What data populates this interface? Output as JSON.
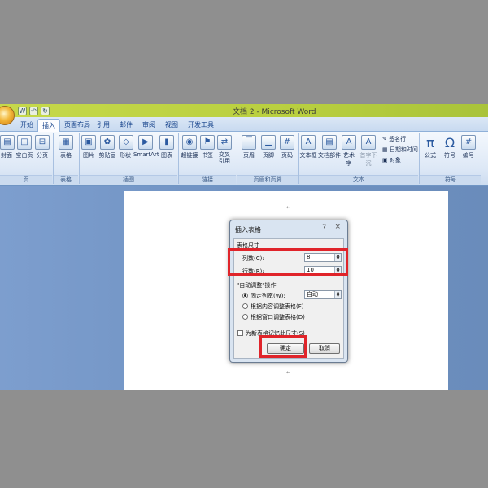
{
  "window": {
    "title": "文档 2 - Microsoft Word"
  },
  "qat": [
    "W",
    "↶",
    "↻"
  ],
  "tabs": [
    "开始",
    "插入",
    "页面布局",
    "引用",
    "邮件",
    "审阅",
    "视图",
    "开发工具"
  ],
  "ribbon": {
    "buttons": [
      "封面",
      "空白页",
      "分页",
      "表格",
      "图片",
      "剪贴画",
      "形状",
      "SmartArt",
      "图表",
      "超链接",
      "书签",
      "交叉\n引用",
      "页眉",
      "页脚",
      "页码",
      "文本框",
      "文档部件",
      "艺术字",
      "首字下沉",
      "公式",
      "符号",
      "编号"
    ],
    "small": [
      "签名行",
      "日期和时间",
      "对象"
    ],
    "groups": [
      "页",
      "表格",
      "插图",
      "链接",
      "页眉和页脚",
      "文本",
      "符号"
    ],
    "icons": {
      "pi": "π",
      "omega": "Ω"
    }
  },
  "document": {
    "para_mark": "↵"
  },
  "dialog": {
    "title": "插入表格",
    "help": "?",
    "close": "×",
    "size_group": "表格尺寸",
    "columns_label": "列数(C):",
    "columns_value": "8",
    "rows_label": "行数(R):",
    "rows_value": "10",
    "autofit_group": "\"自动调整\"操作",
    "opt_fixed": "固定列宽(W):",
    "opt_fixed_value": "自动",
    "opt_content": "根据内容调整表格(F)",
    "opt_window": "根据窗口调整表格(D)",
    "remember": "为新表格记忆此尺寸(S)",
    "ok": "确定",
    "cancel": "取消"
  },
  "colors": {
    "highlight": "#e0242a",
    "title_bar": "#c6d94a",
    "ribbon_text": "#15428b"
  }
}
